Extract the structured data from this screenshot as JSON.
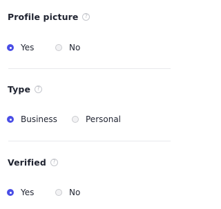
{
  "sections": [
    {
      "title": "Profile picture",
      "help_icon": "?",
      "options": [
        {
          "label": "Yes",
          "selected": true
        },
        {
          "label": "No",
          "selected": false
        }
      ]
    },
    {
      "title": "Type",
      "help_icon": "?",
      "options": [
        {
          "label": "Business",
          "selected": true
        },
        {
          "label": "Personal",
          "selected": false
        }
      ]
    },
    {
      "title": "Verified",
      "help_icon": "?",
      "options": [
        {
          "label": "Yes",
          "selected": true
        },
        {
          "label": "No",
          "selected": false
        }
      ]
    }
  ],
  "colors": {
    "accent": "#4a4ee6",
    "text": "#1f2330",
    "divider": "#e8e9ec"
  }
}
